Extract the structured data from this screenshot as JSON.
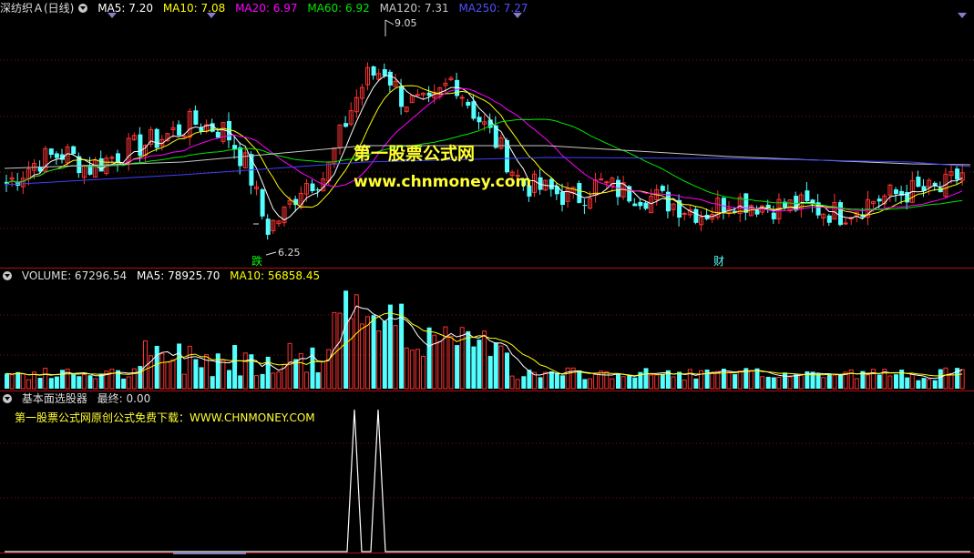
{
  "header_main": {
    "title": "深纺织Ａ(日线)",
    "ma5": "MA5: 7.20",
    "ma10": "MA10: 7.08",
    "ma20": "MA20: 6.97",
    "ma60": "MA60: 6.92",
    "ma120": "MA120: 7.31",
    "ma250": "MA250: 7.27"
  },
  "header_volume": {
    "volume": "VOLUME: 67296.54",
    "ma5": "MA5: 78925.70",
    "ma10": "MA10: 56858.45"
  },
  "header_indicator": {
    "name": "基本面选股器",
    "final": "最终: 0.00",
    "subtitle": "第一股票公式网原创公式免费下载：WWW.CHNMONEY.COM"
  },
  "watermark": {
    "line1": "第一股票公式网",
    "line2": "www.chnmoney.com"
  },
  "annotations": {
    "high_label": "9.05",
    "low_label": "6.25",
    "tag_die": "跌",
    "tag_cai": "财"
  },
  "colors": {
    "up": "#ff3232",
    "down": "#54ffff",
    "ma5": "#ffffff",
    "ma10": "#ffff00",
    "ma20": "#ff00ff",
    "ma60": "#00e600",
    "ma120": "#c8c8c8",
    "ma250": "#4040ff",
    "divider": "#b01010"
  },
  "chart_data": {
    "type": "candlestick",
    "series": "深纺织Ａ 日线",
    "ylim": [
      6.0,
      9.2
    ],
    "price_high": 9.05,
    "price_low": 6.25,
    "ma_lines": [
      "MA5",
      "MA10",
      "MA20",
      "MA60",
      "MA120",
      "MA250"
    ],
    "volume_ma": [
      "MA5",
      "MA10"
    ],
    "indicator": {
      "name": "基本面选股器",
      "final": 0.0,
      "spikes": 2
    }
  }
}
